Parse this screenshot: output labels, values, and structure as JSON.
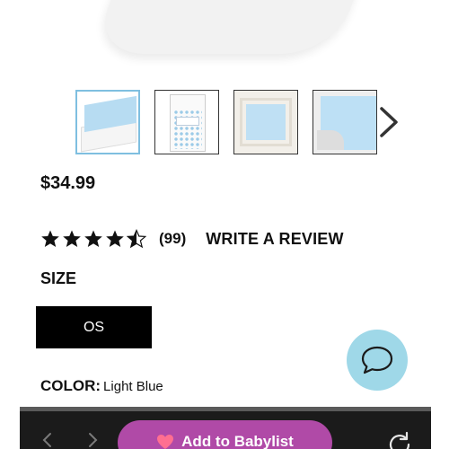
{
  "product": {
    "price": "$34.99",
    "rating": {
      "value": 4.5,
      "max": 5,
      "count_label": "(99)",
      "write_review_label": "WRITE A REVIEW"
    },
    "size": {
      "heading": "SIZE",
      "options": [
        "OS"
      ],
      "selected": "OS"
    },
    "color": {
      "label": "COLOR:",
      "value": "Light Blue"
    }
  },
  "gallery": {
    "thumbnails": [
      "thumb-sheet-corner",
      "thumb-package",
      "thumb-crib",
      "thumb-sheet-detail"
    ],
    "active_index": 0
  },
  "bottom_bar": {
    "add_to_registry_label": "Add to Babylist"
  },
  "colors": {
    "thumb_active_border": "#7fbfe0",
    "chat_button": "#9fd8e8",
    "babylist_button": "#b04aa7",
    "size_selected_bg": "#000000",
    "heart": "#ff6f91"
  },
  "icons": {
    "next": "chevron-right-icon",
    "chat": "chat-bubble-icon",
    "back": "chevron-left-icon",
    "forward": "chevron-right-icon",
    "reload": "reload-icon",
    "heart": "heart-icon",
    "star": "star-icon"
  }
}
